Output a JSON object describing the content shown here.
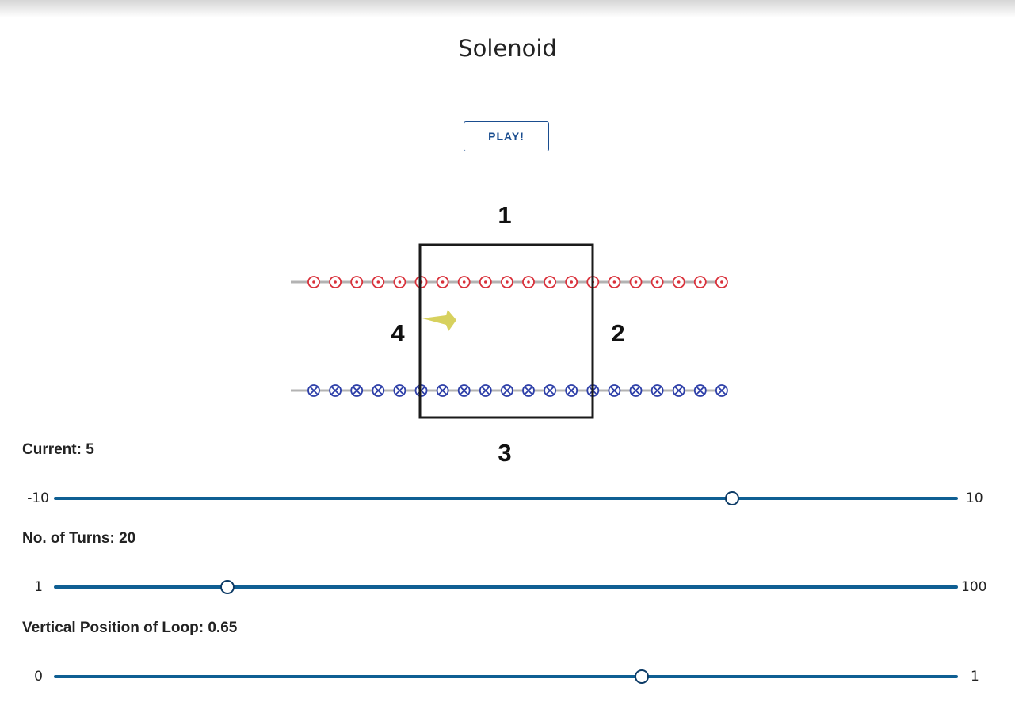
{
  "title": "Solenoid",
  "play_button": "PLAY!",
  "diagram": {
    "side_labels": [
      "1",
      "2",
      "3",
      "4"
    ],
    "wire_count": 20,
    "top_row": {
      "color": "#d9313b",
      "symbol": "dot"
    },
    "bottom_row": {
      "color": "#2d3fa8",
      "symbol": "cross"
    },
    "arrow_color": "#d7d15e",
    "loop_vertical_position": 0.65
  },
  "sliders": [
    {
      "label": "Current: ",
      "value": "5",
      "min": "-10",
      "max": "10",
      "numeric": {
        "min": -10,
        "max": 10,
        "value": 5
      }
    },
    {
      "label": "No. of Turns: ",
      "value": "20",
      "min": "1",
      "max": "100",
      "numeric": {
        "min": 1,
        "max": 100,
        "value": 20
      }
    },
    {
      "label": "Vertical Position of Loop: ",
      "value": "0.65",
      "min": "0",
      "max": "1",
      "numeric": {
        "min": 0,
        "max": 1,
        "value": 0.65
      }
    }
  ],
  "colors": {
    "slider_track": "#0f5f93",
    "slider_thumb_border": "#0d3b66",
    "button_text": "#1a4d8f"
  }
}
